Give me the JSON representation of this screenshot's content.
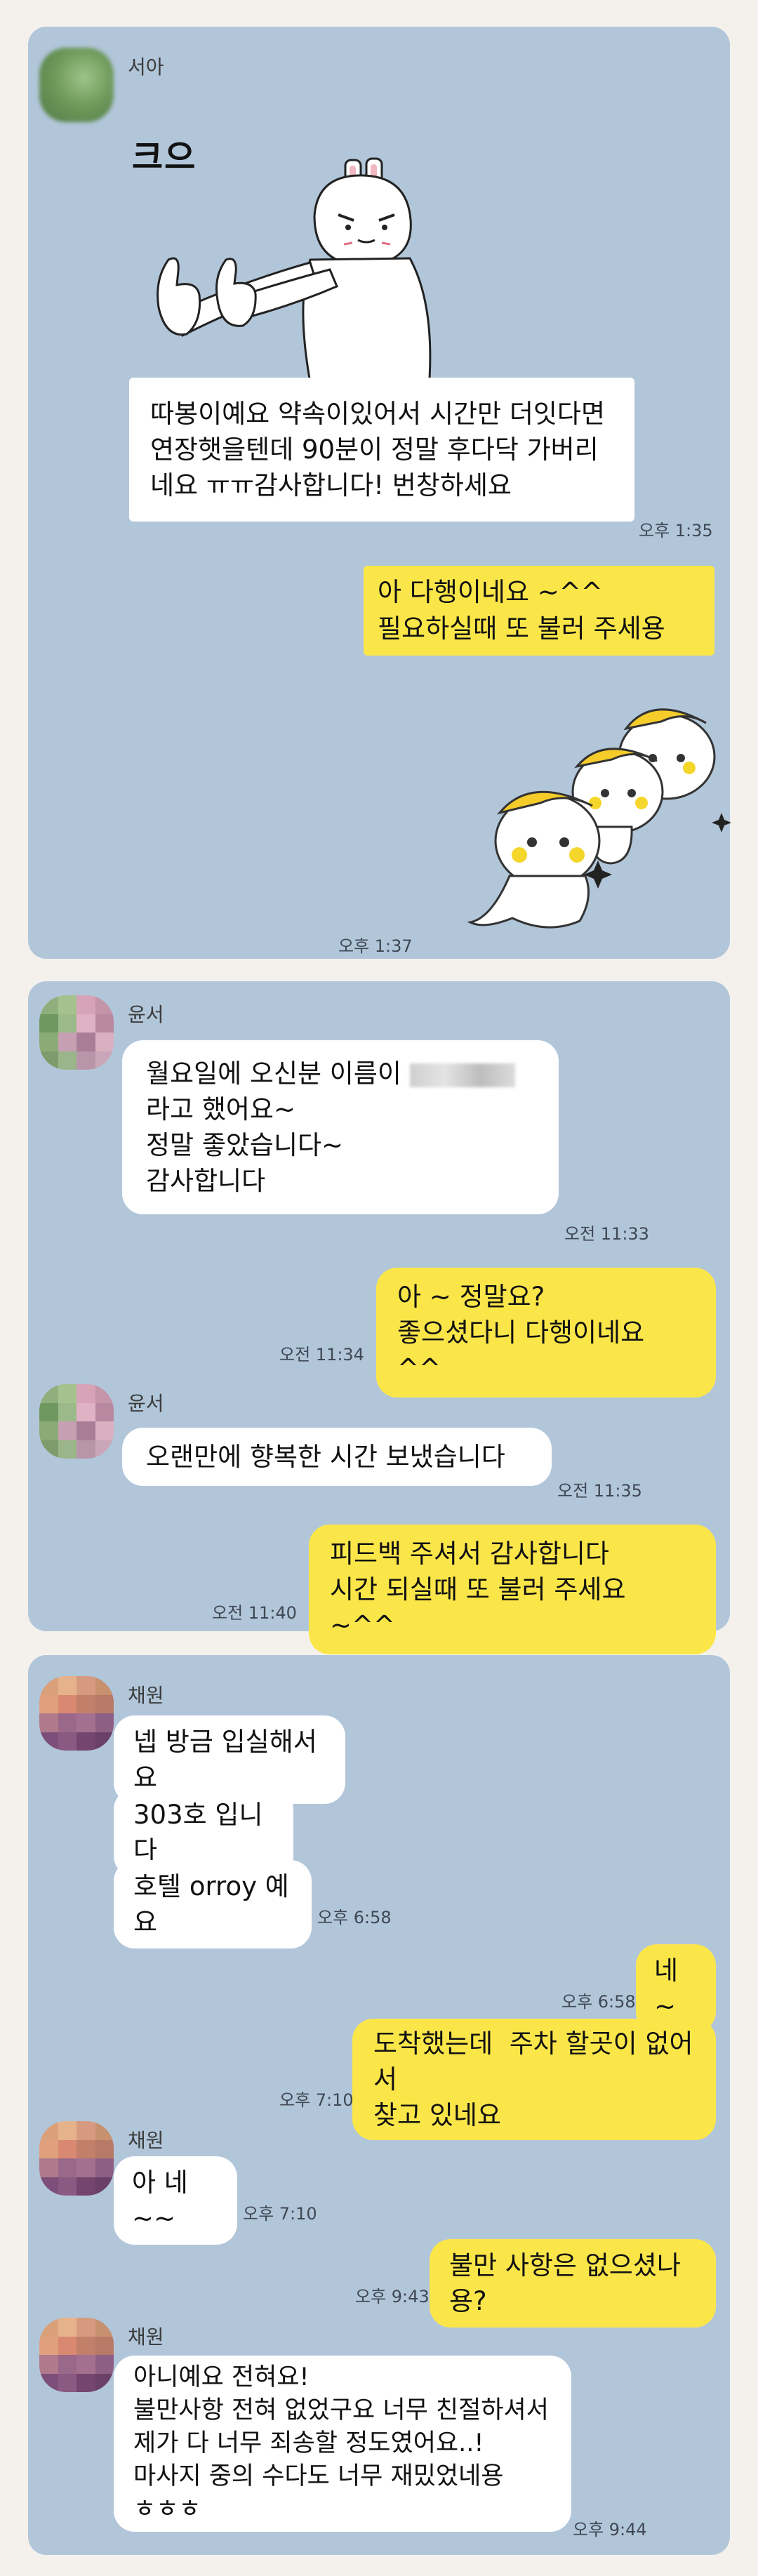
{
  "panel1": {
    "sender": "서아",
    "sticker_caption": "크으",
    "message": "따봉이예요 약속이있어서 시간만 더잇다면 연장햇을텐데 90분이 정말 후다닥 가버리네요 ㅠㅠ감사합니다! 번창하세요",
    "message_time": "오후 1:35",
    "reply": "아 다행이네요 ~^^\n필요하실때 또 불러 주세용",
    "sticker_time": "오후 1:37"
  },
  "panel2": {
    "sender1": "윤서",
    "msg1_a": "월요일에 오신분 이름이 ",
    "msg1_b": "라고 했어요~\n정말 좋았습니다~\n감사합니다",
    "msg1_time": "오전 11:33",
    "reply1": "아 ~ 정말요?\n좋으셨다니 다행이네요 ^^",
    "reply1_time": "오전 11:34",
    "sender2": "윤서",
    "msg2": "오랜만에 향복한 시간 보냈습니다",
    "msg2_time": "오전 11:35",
    "reply2": "피드백 주셔서 감사합니다\n시간 되실때 또 불러 주세요 ~^^",
    "reply2_time": "오전 11:40"
  },
  "panel3": {
    "sender1": "채원",
    "m1": "넵 방금 입실해서요",
    "m2": "303호 입니다",
    "m3": "호텔 orroy 예요",
    "m3_time": "오후 6:58",
    "r1": "네 ~",
    "r1_time": "오후 6:58",
    "r2": "도착했는데  주차 할곳이 없어서\n찾고 있네요",
    "r2_time": "오후 7:10",
    "sender2": "채원",
    "m4": "아 네~~",
    "m4_time": "오후 7:10",
    "r3": "불만 사항은 없으셨나용?",
    "r3_time": "오후 9:43",
    "sender3": "채원",
    "m5": "아니예요 전혀요!\n불만사항 전혀 없었구요 너무 친절하셔서\n제가 다 너무 죄송할 정도였어요..!\n마사지 중의 수다도 너무 재밌었네용\nㅎㅎㅎ",
    "m5_time": "오후 9:44"
  },
  "colors": {
    "chat_bg": "#b2c6da",
    "my_bubble": "#fbe64a",
    "their_bubble": "#ffffff"
  }
}
